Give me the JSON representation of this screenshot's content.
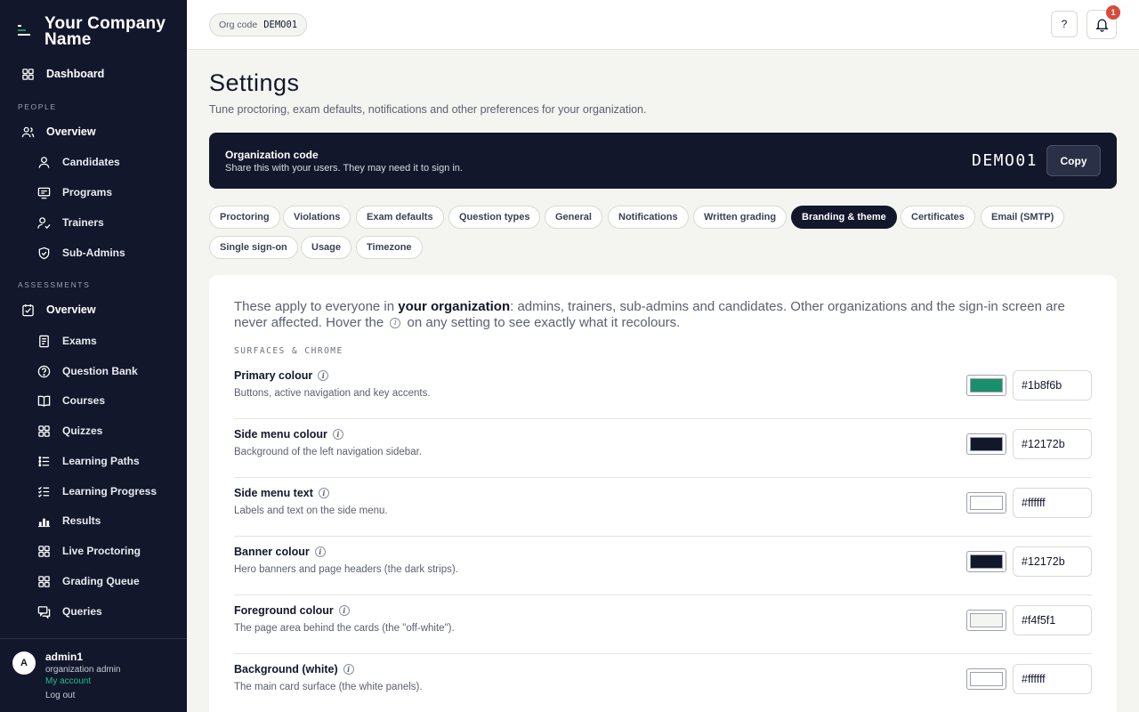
{
  "brand": {
    "name": "Your Company Name"
  },
  "sidebar": {
    "dashboard": "Dashboard",
    "people_section": "PEOPLE",
    "people_overview": "Overview",
    "people_items": [
      "Candidates",
      "Programs",
      "Trainers",
      "Sub-Admins"
    ],
    "assessments_section": "ASSESSMENTS",
    "assessments_overview": "Overview",
    "assessments_items": [
      "Exams",
      "Question Bank",
      "Courses",
      "Quizzes",
      "Learning Paths",
      "Learning Progress",
      "Results",
      "Live Proctoring",
      "Grading Queue",
      "Queries"
    ]
  },
  "user": {
    "initial": "A",
    "name": "admin1",
    "role": "organization admin",
    "account_link": "My account",
    "logout_link": "Log out"
  },
  "topbar": {
    "org_label": "Org code",
    "org_code": "DEMO01",
    "help_label": "?",
    "notification_count": "1"
  },
  "page": {
    "title": "Settings",
    "subtitle": "Tune proctoring, exam defaults, notifications and other preferences for your organization."
  },
  "org_banner": {
    "title": "Organization code",
    "description": "Share this with your users. They may need it to sign in.",
    "code": "DEMO01",
    "copy_label": "Copy"
  },
  "tabs": [
    "Proctoring",
    "Violations",
    "Exam defaults",
    "Question types",
    "General",
    "Notifications",
    "Written grading",
    "Branding & theme",
    "Certificates",
    "Email (SMTP)",
    "Single sign-on",
    "Usage",
    "Timezone"
  ],
  "active_tab": "Branding & theme",
  "branding": {
    "intro_part1": "These apply to everyone in ",
    "intro_bold": "your organization",
    "intro_part2": ": admins, trainers, sub-admins and candidates. Other organizations and the sign-in screen are never affected. Hover the ",
    "intro_part3": " on any setting to see exactly what it recolours.",
    "section_label": "SURFACES & CHROME",
    "settings": [
      {
        "name": "Primary colour",
        "description": "Buttons, active navigation and key accents.",
        "value": "#1b8f6b"
      },
      {
        "name": "Side menu colour",
        "description": "Background of the left navigation sidebar.",
        "value": "#12172b"
      },
      {
        "name": "Side menu text",
        "description": "Labels and text on the side menu.",
        "value": "#ffffff"
      },
      {
        "name": "Banner colour",
        "description": "Hero banners and page headers (the dark strips).",
        "value": "#12172b"
      },
      {
        "name": "Foreground colour",
        "description": "The page area behind the cards (the \"off-white\").",
        "value": "#f4f5f1"
      },
      {
        "name": "Background (white)",
        "description": "The main card surface (the white panels).",
        "value": "#ffffff"
      }
    ]
  },
  "colors": {
    "sidebar_bg": "#12172b",
    "accent": "#1b8f6b",
    "page_bg": "#f4f5f1",
    "badge": "#d94a3a"
  }
}
